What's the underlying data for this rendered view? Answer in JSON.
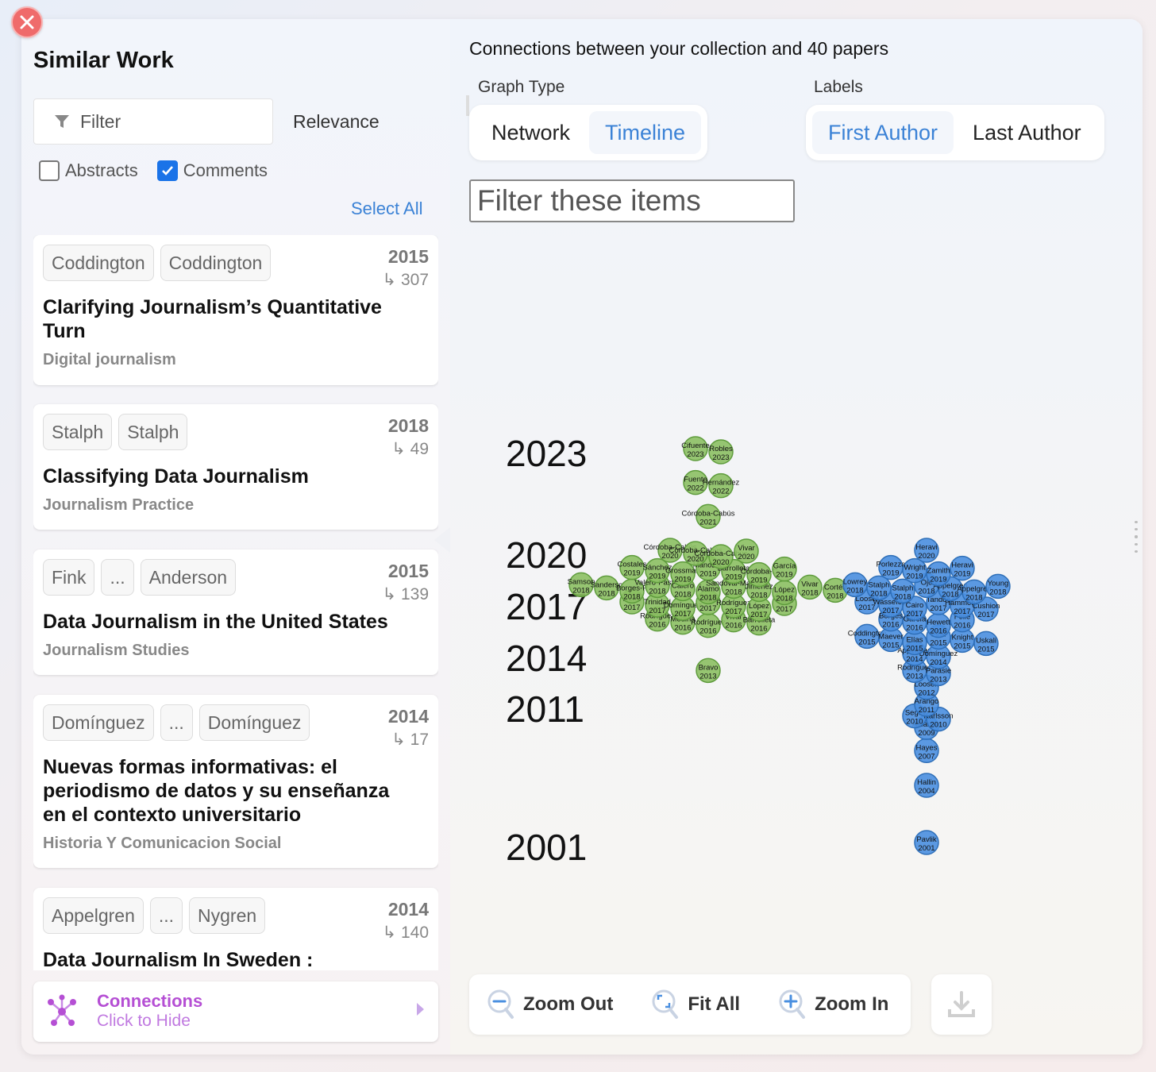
{
  "window": {
    "close_label": "Close"
  },
  "sidebar": {
    "title": "Similar Work",
    "filter_placeholder": "Filter",
    "sort": "Relevance",
    "abstracts_label": "Abstracts",
    "abstracts_checked": false,
    "comments_label": "Comments",
    "comments_checked": true,
    "select_all": "Select All",
    "papers": [
      {
        "chips": [
          "Coddington",
          "Coddington"
        ],
        "year": "2015",
        "citations": "↳ 307",
        "title": "Clarifying Journalism’s Quantitative Turn",
        "journal": "Digital journalism"
      },
      {
        "chips": [
          "Stalph",
          "Stalph"
        ],
        "year": "2018",
        "citations": "↳ 49",
        "title": "Classifying Data Journalism",
        "journal": "Journalism Practice"
      },
      {
        "chips": [
          "Fink",
          "...",
          "Anderson"
        ],
        "year": "2015",
        "citations": "↳ 139",
        "title": "Data Journalism in the United States",
        "journal": "Journalism Studies"
      },
      {
        "chips": [
          "Domínguez",
          "...",
          "Domínguez"
        ],
        "year": "2014",
        "citations": "↳ 17",
        "title": "Nuevas formas informativas: el periodismo de datos y su enseñanza en el contexto universitario",
        "journal": "Historia Y Comunicacion Social"
      },
      {
        "chips": [
          "Appelgren",
          "...",
          "Nygren"
        ],
        "year": "2014",
        "citations": "↳ 140",
        "title": "Data Journalism In Sweden :",
        "journal": ""
      }
    ],
    "connections": {
      "title": "Connections",
      "subtitle": "Click to Hide"
    }
  },
  "main": {
    "heading": "Connections between your collection and 40 papers",
    "graph_type_label": "Graph Type",
    "graph_types": [
      "Network",
      "Timeline"
    ],
    "graph_type_selected": "Timeline",
    "labels_label": "Labels",
    "label_options": [
      "First Author",
      "Last Author"
    ],
    "label_selected": "First Author",
    "filter_placeholder": "Filter these items",
    "year_axis": [
      "2023",
      "2020",
      "2017",
      "2014",
      "2011",
      "2001"
    ],
    "toolbar": {
      "zoom_out": "Zoom Out",
      "fit_all": "Fit All",
      "zoom_in": "Zoom In"
    }
  },
  "colors": {
    "accent": "#3b82d6",
    "green_node": "#8cc063",
    "blue_node": "#4a8fe0",
    "connections": "#b54fd4",
    "close": "#ef6b6b"
  },
  "icons": [
    "close-icon",
    "filter-icon",
    "connections-icon",
    "zoom-out-icon",
    "fit-all-icon",
    "zoom-in-icon",
    "download-icon"
  ],
  "green_nodes": [
    {
      "label": "Cifuente",
      "year": "2023"
    },
    {
      "label": "Robles",
      "year": "2023"
    },
    {
      "label": "Fuente",
      "year": "2022"
    },
    {
      "label": "Hernández",
      "year": "2022"
    },
    {
      "label": "Córdoba-Cabús",
      "year": "2021"
    },
    {
      "label": "Córdoba-Cabús",
      "year": "2020"
    },
    {
      "label": "Córdoba-Cabús",
      "year": "2020"
    },
    {
      "label": "Córdoba-Cabús",
      "year": "2020"
    },
    {
      "label": "Vivar",
      "year": "2020"
    },
    {
      "label": "Costales",
      "year": "2019"
    },
    {
      "label": "Sánchez",
      "year": "2019"
    },
    {
      "label": "Grossman",
      "year": "2019"
    },
    {
      "label": "Manozzo",
      "year": "2019"
    },
    {
      "label": "Barrolleta",
      "year": "2019"
    },
    {
      "label": "Samson",
      "year": "2018"
    },
    {
      "label": "Córdoba-C",
      "year": "2019"
    },
    {
      "label": "Sanderso",
      "year": "2018"
    },
    {
      "label": "García",
      "year": "2019"
    },
    {
      "label": "Borges-R",
      "year": "2018"
    },
    {
      "label": "Valero-Pastor",
      "year": "2018"
    },
    {
      "label": "Calero",
      "year": "2018"
    },
    {
      "label": "Álamo",
      "year": "2018"
    },
    {
      "label": "Sandoval-Martín",
      "year": "2018"
    },
    {
      "label": "Jiménez",
      "year": "2018"
    },
    {
      "label": "López",
      "year": "2018"
    },
    {
      "label": "Reno",
      "year": "2017"
    },
    {
      "label": "Vivar",
      "year": "2018"
    },
    {
      "label": "Trinidad",
      "year": "2017"
    },
    {
      "label": "Domínguez",
      "year": "2017"
    },
    {
      "label": "Ruiz",
      "year": "2017"
    },
    {
      "label": "Cortés",
      "year": "2018"
    },
    {
      "label": "Rodríguez",
      "year": "2016"
    },
    {
      "label": "Rodríguez",
      "year": "2017"
    },
    {
      "label": "López",
      "year": "2017"
    },
    {
      "label": "Medina",
      "year": "2016"
    },
    {
      "label": "Cano",
      "year": "2017"
    },
    {
      "label": "Rodríguez",
      "year": "2016"
    },
    {
      "label": "Vivar",
      "year": "2016"
    },
    {
      "label": "Barrolleta",
      "year": "2016"
    },
    {
      "label": "Bravo",
      "year": "2013"
    }
  ],
  "blue_nodes": [
    {
      "label": "Looser",
      "year": "2017"
    },
    {
      "label": "Lowrey",
      "year": "2018"
    },
    {
      "label": "Wassefoer",
      "year": "2017"
    },
    {
      "label": "Porlezza",
      "year": "2019"
    },
    {
      "label": "Wright",
      "year": "2019"
    },
    {
      "label": "Heravi",
      "year": "2020"
    },
    {
      "label": "Zamith",
      "year": "2019"
    },
    {
      "label": "Stalph",
      "year": "2018"
    },
    {
      "label": "Heravi",
      "year": "2019"
    },
    {
      "label": "Stalph",
      "year": "2018"
    },
    {
      "label": "Cairo",
      "year": "2017"
    },
    {
      "label": "Ojo",
      "year": "2018"
    },
    {
      "label": "Appelgren",
      "year": "2018"
    },
    {
      "label": "Tandoc",
      "year": "2017"
    },
    {
      "label": "Appelgren",
      "year": "2018"
    },
    {
      "label": "Young",
      "year": "2018"
    },
    {
      "label": "Hammond",
      "year": "2017"
    },
    {
      "label": "Cushion",
      "year": "2017"
    },
    {
      "label": "Borges",
      "year": "2016"
    },
    {
      "label": "Coddington",
      "year": "2015"
    },
    {
      "label": "García",
      "year": "2016"
    },
    {
      "label": "Maever",
      "year": "2015"
    },
    {
      "label": "Hewett",
      "year": "2016"
    },
    {
      "label": "Elías",
      "year": "2015"
    },
    {
      "label": "Fink",
      "year": "2015"
    },
    {
      "label": "Felle",
      "year": "2016"
    },
    {
      "label": "Appelgren",
      "year": "2014"
    },
    {
      "label": "Knight",
      "year": "2015"
    },
    {
      "label": "Uskali",
      "year": "2015"
    },
    {
      "label": "Domínguez",
      "year": "2014"
    },
    {
      "label": "Rodríguez",
      "year": "2013"
    },
    {
      "label": "Parasie",
      "year": "2013"
    },
    {
      "label": "Loosen",
      "year": "2012"
    },
    {
      "label": "Arango",
      "year": "2011"
    },
    {
      "label": "Segel",
      "year": "2010"
    },
    {
      "label": "Karlsson",
      "year": "2010"
    },
    {
      "label": "Albarran",
      "year": "2009"
    },
    {
      "label": "Hayes",
      "year": "2007"
    },
    {
      "label": "Hallin",
      "year": "2004"
    },
    {
      "label": "Pavlik",
      "year": "2001"
    }
  ]
}
